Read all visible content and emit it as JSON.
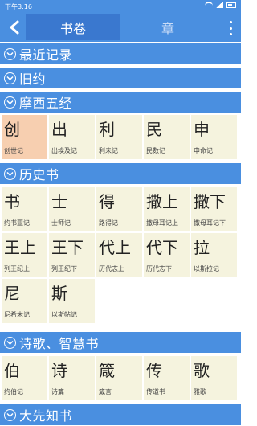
{
  "status": {
    "time": "下午3:16"
  },
  "toolbar": {
    "tabs": [
      {
        "label": "书卷"
      },
      {
        "label": "章"
      }
    ]
  },
  "sections": [
    {
      "title": "最近记录",
      "books": []
    },
    {
      "title": "旧约",
      "books": []
    },
    {
      "title": "摩西五经",
      "books": [
        {
          "short": "创",
          "full": "创世记"
        },
        {
          "short": "出",
          "full": "出埃及记"
        },
        {
          "short": "利",
          "full": "利未记"
        },
        {
          "short": "民",
          "full": "民数记"
        },
        {
          "short": "申",
          "full": "申命记"
        }
      ]
    },
    {
      "title": "历史书",
      "books": [
        {
          "short": "书",
          "full": "约书亚记"
        },
        {
          "short": "士",
          "full": "士师记"
        },
        {
          "short": "得",
          "full": "路得记"
        },
        {
          "short": "撒上",
          "full": "撒母耳记上"
        },
        {
          "short": "撒下",
          "full": "撒母耳记下"
        },
        {
          "short": "王上",
          "full": "列王纪上"
        },
        {
          "short": "王下",
          "full": "列王纪下"
        },
        {
          "short": "代上",
          "full": "历代志上"
        },
        {
          "short": "代下",
          "full": "历代志下"
        },
        {
          "short": "拉",
          "full": "以斯拉记"
        },
        {
          "short": "尼",
          "full": "尼希米记"
        },
        {
          "short": "斯",
          "full": "以斯帖记"
        }
      ]
    },
    {
      "title": "诗歌、智慧书",
      "books": [
        {
          "short": "伯",
          "full": "约伯记"
        },
        {
          "short": "诗",
          "full": "诗篇"
        },
        {
          "short": "箴",
          "full": "箴言"
        },
        {
          "short": "传",
          "full": "传道书"
        },
        {
          "short": "歌",
          "full": "雅歌"
        }
      ]
    },
    {
      "title": "大先知书",
      "books": []
    }
  ],
  "colors": {
    "accent": "#4a8fe0",
    "tab_active": "#3a78cf",
    "cell_bg": "#f5f3de",
    "cell_highlight": "#f7cfb0"
  }
}
